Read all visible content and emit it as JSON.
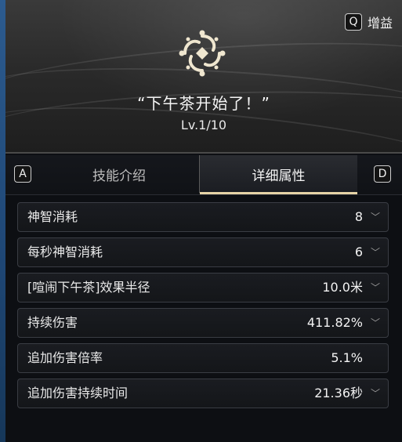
{
  "header": {
    "gain_key": "Q",
    "gain_label": "增益",
    "emblem_icon": "swirl-emblem-icon",
    "skill_name": "“下午茶开始了！”",
    "level": "Lv.1/10"
  },
  "tabs": {
    "left_key": "A",
    "right_key": "D",
    "items": [
      {
        "label": "技能介绍",
        "active": false
      },
      {
        "label": "详细属性",
        "active": true
      }
    ]
  },
  "attributes": [
    {
      "label": "神智消耗",
      "value": "8",
      "expandable": true
    },
    {
      "label": "每秒神智消耗",
      "value": "6",
      "expandable": true
    },
    {
      "label": "[喧闹下午茶]效果半径",
      "value": "10.0米",
      "expandable": true
    },
    {
      "label": "持续伤害",
      "value": "411.82%",
      "expandable": true
    },
    {
      "label": "追加伤害倍率",
      "value": "5.1%",
      "expandable": false
    },
    {
      "label": "追加伤害持续时间",
      "value": "21.36秒",
      "expandable": true
    }
  ],
  "colors": {
    "accent_underline": "#e6d3a6",
    "edge_blue": "#2c5b8f",
    "emblem": "#efe6cf"
  }
}
